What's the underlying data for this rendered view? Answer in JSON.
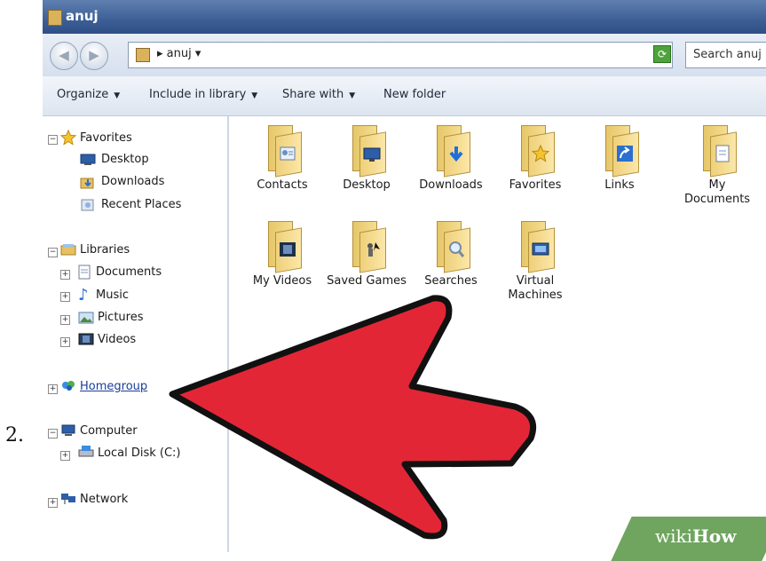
{
  "step_number": "2.",
  "window": {
    "title": "anuj"
  },
  "address": {
    "path": "▸ anuj ▾",
    "dropdown": "▾"
  },
  "search": {
    "placeholder": "Search anuj"
  },
  "toolbar": {
    "organize": "Organize",
    "include_in_library": "Include in library",
    "share_with": "Share with",
    "new_folder": "New folder"
  },
  "sidebar": {
    "favorites": {
      "label": "Favorites",
      "items": [
        "Desktop",
        "Downloads",
        "Recent Places"
      ]
    },
    "libraries": {
      "label": "Libraries",
      "items": [
        "Documents",
        "Music",
        "Pictures",
        "Videos"
      ]
    },
    "homegroup": "Homegroup",
    "computer": {
      "label": "Computer",
      "items": [
        "Local Disk (C:)"
      ]
    },
    "network": "Network"
  },
  "folders": [
    {
      "name": "Contacts",
      "icon": "contacts-icon"
    },
    {
      "name": "Desktop",
      "icon": "desktop-icon"
    },
    {
      "name": "Downloads",
      "icon": "downloads-icon"
    },
    {
      "name": "Favorites",
      "icon": "favorites-star-icon"
    },
    {
      "name": "Links",
      "icon": "links-arrow-icon"
    },
    {
      "name": "My Documents",
      "icon": "documents-icon"
    },
    {
      "name": "My Videos",
      "icon": "videos-icon"
    },
    {
      "name": "Saved Games",
      "icon": "saved-games-icon"
    },
    {
      "name": "Searches",
      "icon": "magnifier-icon"
    },
    {
      "name": "Virtual Machines",
      "icon": "virtual-machines-icon"
    }
  ],
  "watermark": {
    "wiki": "wiki",
    "how": "How"
  },
  "colors": {
    "arrow": "#e32636",
    "title_bar": "#3d5f95",
    "watermark": "#6fa55f"
  }
}
